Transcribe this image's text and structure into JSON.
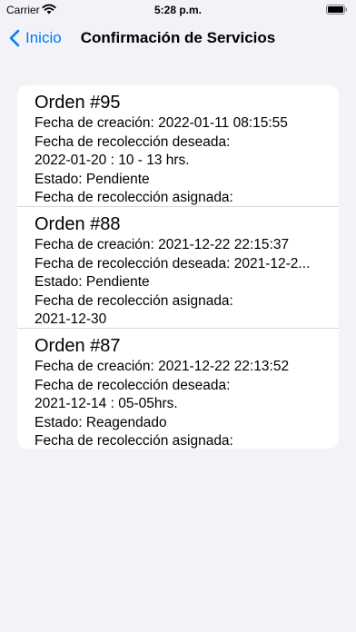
{
  "status_bar": {
    "carrier": "Carrier",
    "time": "5:28 p.m."
  },
  "nav": {
    "back_label": "Inicio",
    "title": "Confirmación de Servicios"
  },
  "colors": {
    "accent": "#007aff",
    "background": "#f2f2f7",
    "card": "#ffffff"
  },
  "orders": [
    {
      "title": "Orden #95",
      "lines": [
        "Fecha de creación: 2022-01-11 08:15:55",
        "Fecha de recolección deseada:",
        "2022-01-20 : 10 - 13 hrs.",
        "Estado: Pendiente",
        "Fecha de recolección asignada:"
      ]
    },
    {
      "title": "Orden #88",
      "lines": [
        "Fecha de creación: 2021-12-22 22:15:37",
        "Fecha de recolección deseada: 2021-12-2...",
        "Estado: Pendiente",
        "Fecha de recolección asignada:",
        "2021-12-30"
      ]
    },
    {
      "title": "Orden #87",
      "lines": [
        "Fecha de creación: 2021-12-22 22:13:52",
        "Fecha de recolección deseada:",
        "2021-12-14 : 05-05hrs.",
        "Estado: Reagendado",
        "Fecha de recolección asignada:"
      ]
    }
  ]
}
